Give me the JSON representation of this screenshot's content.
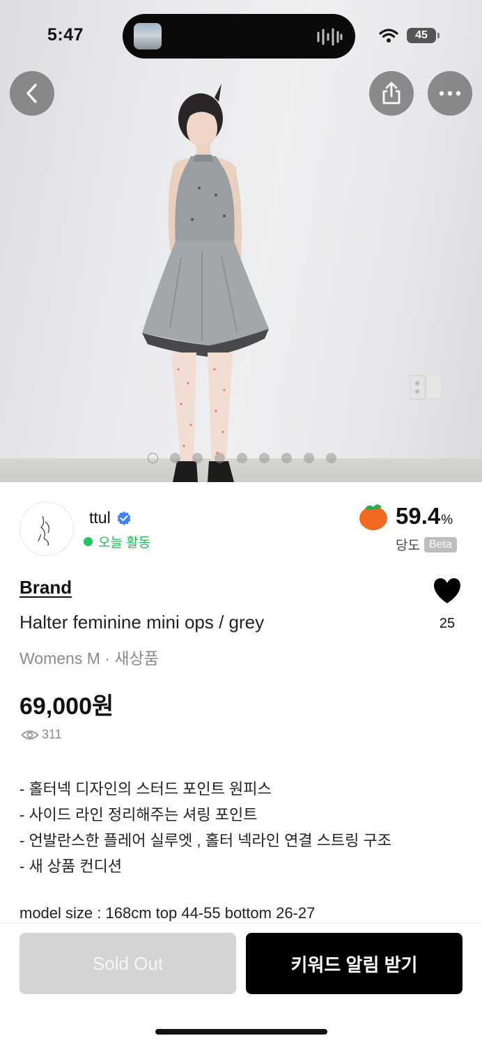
{
  "status_bar": {
    "time": "5:47",
    "battery": "45"
  },
  "hero": {
    "page_dots": {
      "count": 9,
      "active_index": 0
    }
  },
  "seller": {
    "name": "ttul",
    "verified": true,
    "activity": "오늘 활동"
  },
  "ripeness": {
    "value": "59.4",
    "unit": "%",
    "label": "당도",
    "badge": "Beta"
  },
  "product": {
    "brand": "Brand",
    "title": "Halter feminine mini ops / grey",
    "meta": "Womens M · 새상품",
    "price": "69,000원",
    "views": "311",
    "likes": "25",
    "description": [
      "- 홀터넥 디자인의 스터드 포인트 원피스",
      "- 사이드 라인 정리해주는 셔링 포인트",
      "- 언발란스한 플레어 실루엣 , 홀터 넥라인 연결 스트링 구조",
      "- 새 상품 컨디션"
    ],
    "model_size": "model size : 168cm top 44-55 bottom 26-27"
  },
  "actions": {
    "sold_out": "Sold Out",
    "keyword_alert": "키워드 알림 받기"
  },
  "colors": {
    "accent_green": "#22c55e",
    "verified_blue": "#3b82f6",
    "orange": "#f26a21",
    "primary_button": "#000000",
    "disabled_button": "#d4d4d4"
  }
}
